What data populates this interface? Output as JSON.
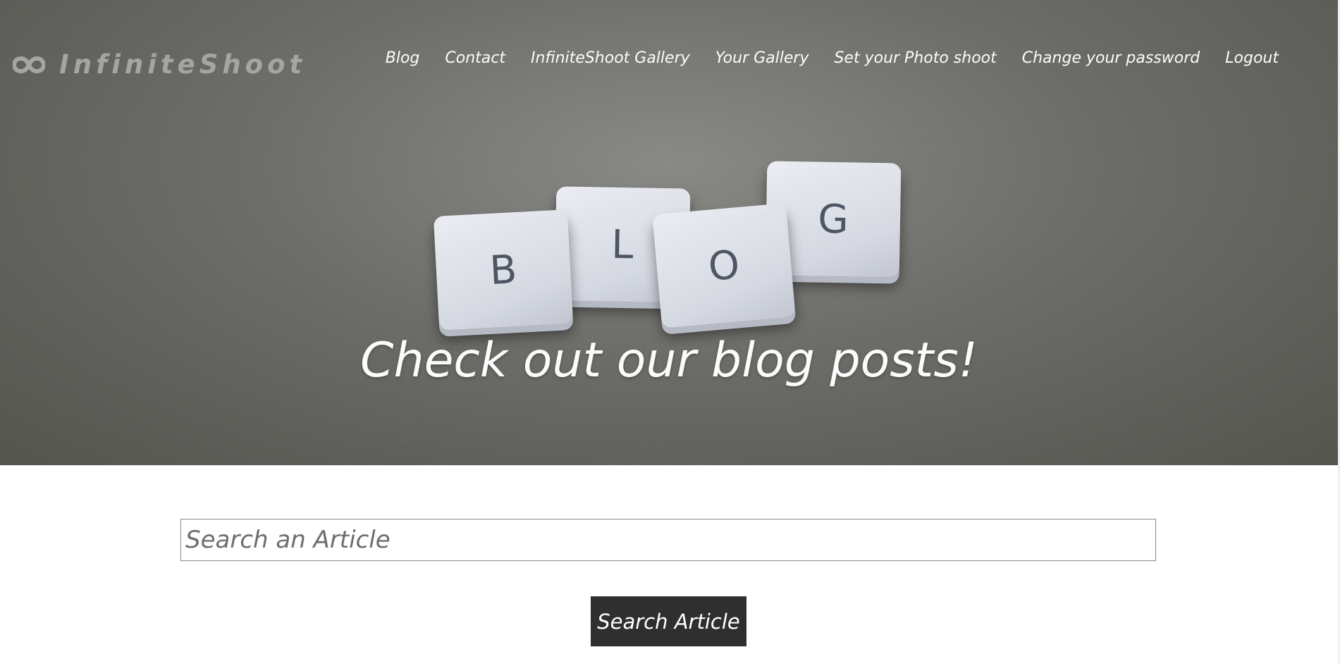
{
  "brand": {
    "name": "InfiniteShoot",
    "icon": "infinity-icon"
  },
  "nav": {
    "items": [
      {
        "label": "Blog"
      },
      {
        "label": "Contact"
      },
      {
        "label": "InfiniteShoot Gallery"
      },
      {
        "label": "Your Gallery"
      },
      {
        "label": "Set your Photo shoot"
      },
      {
        "label": "Change your password"
      },
      {
        "label": "Logout"
      }
    ]
  },
  "hero": {
    "tiles": [
      "B",
      "L",
      "O",
      "G"
    ],
    "heading": "Check out our blog posts!"
  },
  "search": {
    "placeholder": "Search an Article",
    "value": "",
    "button_label": "Search Article"
  },
  "colors": {
    "hero_background": "#6d6d69",
    "button_background": "#2f2f2f",
    "logo_text": "#a6a6a2",
    "tile": "#dfe2ea"
  }
}
